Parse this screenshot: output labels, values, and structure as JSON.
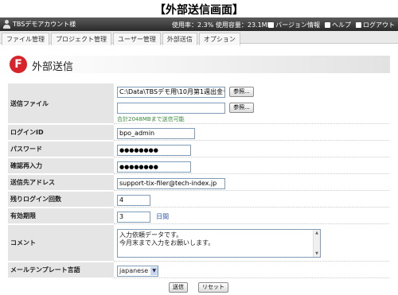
{
  "caption": "【外部送信画面】",
  "topbar": {
    "account": "TBSデモアカウント様",
    "usage_rate": "使用率：2.3%",
    "usage_capacity": "使用容量：23.1MB",
    "version_link": "バージョン情報",
    "help_link": "ヘルプ",
    "logout_link": "ログアウト"
  },
  "nav": [
    "ファイル管理",
    "プロジェクト管理",
    "ユーザー管理",
    "外部送信",
    "オプション"
  ],
  "page_title": "外部送信",
  "form": {
    "file_label": "送信ファイル",
    "file_path": "C:\\Data\\TBSデモ用\\10月第1週出金デ",
    "file_path2": "",
    "browse": "参照...",
    "file_note": "合計2048MBまで送信可能",
    "login_label": "ログインID",
    "login_value": "bpo_admin",
    "password_label": "パスワード",
    "password_value": "●●●●●●●●",
    "confirm_label": "確認再入力",
    "confirm_value": "●●●●●●●●",
    "address_label": "送信先アドレス",
    "address_value": "support-tix-filer@tech-index.jp",
    "remaining_label": "残りログイン回数",
    "remaining_value": "4",
    "expiry_label": "有効期限",
    "expiry_value": "3",
    "expiry_unit": "日間",
    "comment_label": "コメント",
    "comment_line1": "入力依頼データです。",
    "comment_line2": "今月末まで入力をお願いします。",
    "template_label": "メールテンプレート言語",
    "template_value": "japanese",
    "send_button": "送信",
    "reset_button": "リセット"
  }
}
